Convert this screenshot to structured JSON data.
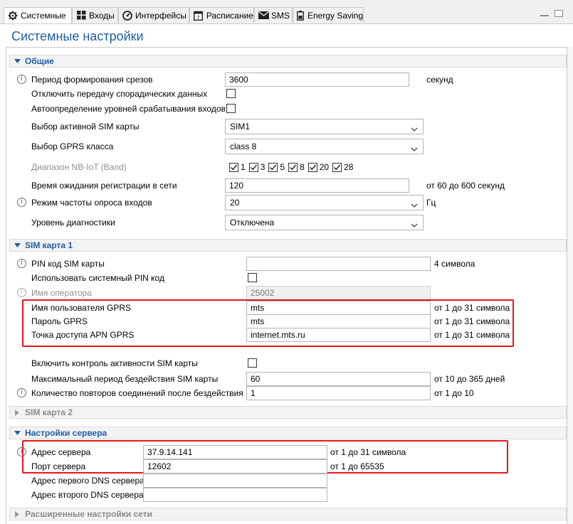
{
  "tabs": [
    {
      "label": "Системные",
      "icon": "gear-icon"
    },
    {
      "label": "Входы",
      "icon": "grid-icon"
    },
    {
      "label": "Интерфейсы",
      "icon": "gauge-icon"
    },
    {
      "label": "Расписание",
      "icon": "calendar-icon"
    },
    {
      "label": "SMS",
      "icon": "envelope-icon"
    },
    {
      "label": "Energy Saving",
      "icon": "battery-icon"
    }
  ],
  "page_title": "Системные настройки",
  "general": {
    "header": "Общие",
    "slice_period": {
      "label": "Период формирования срезов",
      "value": "3600",
      "unit": "секунд"
    },
    "disable_sporadic": {
      "label": "Отключить передачу спорадических данных",
      "checked": false
    },
    "auto_levels": {
      "label": "Автоопределение уровней срабатывания входов",
      "checked": false
    },
    "sim_select": {
      "label": "Выбор активной SIM карты",
      "value": "SIM1"
    },
    "gprs_class": {
      "label": "Выбор GPRS класса",
      "value": "class 8"
    },
    "nbiot_band": {
      "label": "Диапазон NB-IoT (Band)",
      "bands": [
        "1",
        "3",
        "5",
        "8",
        "20",
        "28"
      ]
    },
    "reg_wait": {
      "label": "Время ожидания регистрации в сети",
      "value": "120",
      "unit": "от 60 до 600 секунд"
    },
    "poll_freq": {
      "label": "Режим частоты опроса входов",
      "value": "20",
      "unit": "Гц"
    },
    "diag_level": {
      "label": "Уровень диагностики",
      "value": "Отключена"
    }
  },
  "sim1": {
    "header": "SIM карта 1",
    "pin": {
      "label": "PIN код SIM карты",
      "value": "",
      "unit": "4 символа"
    },
    "use_sys_pin": {
      "label": "Использовать системный PIN код",
      "checked": false
    },
    "operator": {
      "label": "Имя оператора",
      "value": "25002"
    },
    "gprs_user": {
      "label": "Имя пользователя GPRS",
      "value": "mts",
      "unit": "от 1 до 31 символа"
    },
    "gprs_pass": {
      "label": "Пароль GPRS",
      "value": "mts",
      "unit": "от 1 до 31 символа"
    },
    "apn": {
      "label": "Точка доступа APN GPRS",
      "value": "internet.mts.ru",
      "unit": "от 1 до 31 символа"
    },
    "activity_ctrl": {
      "label": "Включить контроль активности SIM карты",
      "checked": false
    },
    "max_idle": {
      "label": "Максимальный период бездействия SIM карты",
      "value": "60",
      "unit": "от 10 до 365 дней"
    },
    "retry_count": {
      "label": "Количество повторов соединений после бездействия",
      "value": "1",
      "unit": "от 1 до 10"
    }
  },
  "sim2": {
    "header": "SIM карта 2"
  },
  "server": {
    "header": "Настройки сервера",
    "address": {
      "label": "Адрес сервера",
      "value": "37.9.14.141",
      "unit": "от 1 до 31 символа"
    },
    "port": {
      "label": "Порт сервера",
      "value": "12602",
      "unit": "от 1 до 65535"
    },
    "dns1": {
      "label": "Адрес первого DNS сервера",
      "value": ""
    },
    "dns2": {
      "label": "Адрес второго DNS сервера",
      "value": ""
    }
  },
  "advanced": {
    "header": "Расширенные настройки сети"
  },
  "colors": {
    "accent": "#1f5fa0",
    "highlight": "#e3161b"
  }
}
